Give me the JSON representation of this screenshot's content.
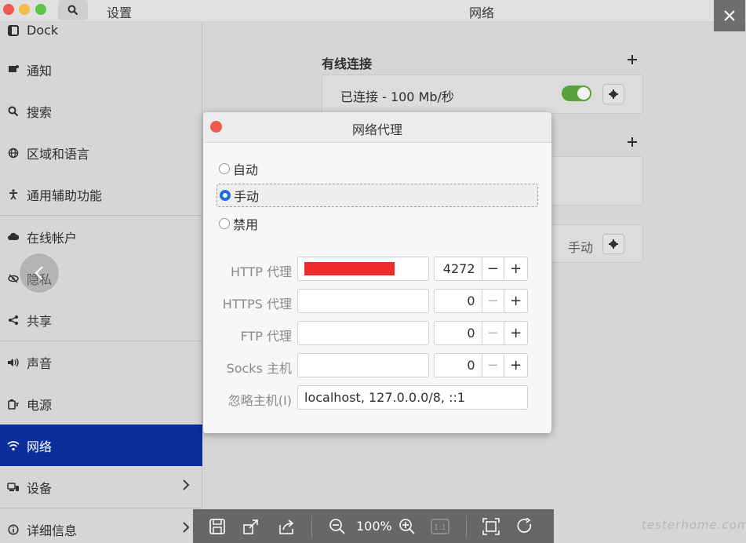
{
  "titlebar": {
    "left_title": "设置",
    "center_title": "网络"
  },
  "sidebar": {
    "items": [
      {
        "label": "Dock",
        "icon": "dock-icon"
      },
      {
        "label": "通知",
        "icon": "notification-icon"
      },
      {
        "label": "搜索",
        "icon": "search-icon"
      },
      {
        "label": "区域和语言",
        "icon": "globe-icon"
      },
      {
        "label": "通用辅助功能",
        "icon": "accessibility-icon"
      },
      {
        "label": "在线帐户",
        "icon": "cloud-icon"
      },
      {
        "label": "隐私",
        "icon": "privacy-icon"
      },
      {
        "label": "共享",
        "icon": "share-icon"
      },
      {
        "label": "声音",
        "icon": "speaker-icon"
      },
      {
        "label": "电源",
        "icon": "battery-icon"
      },
      {
        "label": "网络",
        "icon": "wifi-icon",
        "active": true
      },
      {
        "label": "设备",
        "icon": "devices-icon"
      },
      {
        "label": "详细信息",
        "icon": "info-icon"
      }
    ]
  },
  "main": {
    "wired_section_title": "有线连接",
    "wired_status": "已连接 - 100 Mb/秒",
    "proxy_mode_value": "手动"
  },
  "dialog": {
    "title": "网络代理",
    "options": [
      "自动",
      "手动",
      "禁用"
    ],
    "selected": "手动",
    "fields": [
      {
        "label": "HTTP 代理",
        "port": "4272"
      },
      {
        "label": "HTTPS 代理",
        "port": "0"
      },
      {
        "label": "FTP 代理",
        "port": "0"
      },
      {
        "label": "Socks 主机",
        "port": "0"
      }
    ],
    "ignore_label": "忽略主机(I)",
    "ignore_value": "localhost, 127.0.0.0/8, ::1"
  },
  "viewer": {
    "zoom": "100%",
    "one_to_one": "1:1"
  },
  "watermark": "testerhome.com",
  "colors": {
    "accent": "#0a2e9a",
    "toggle_on": "#59a13a",
    "radio_on": "#1f6fe0",
    "redaction": "#ee2b2b"
  }
}
